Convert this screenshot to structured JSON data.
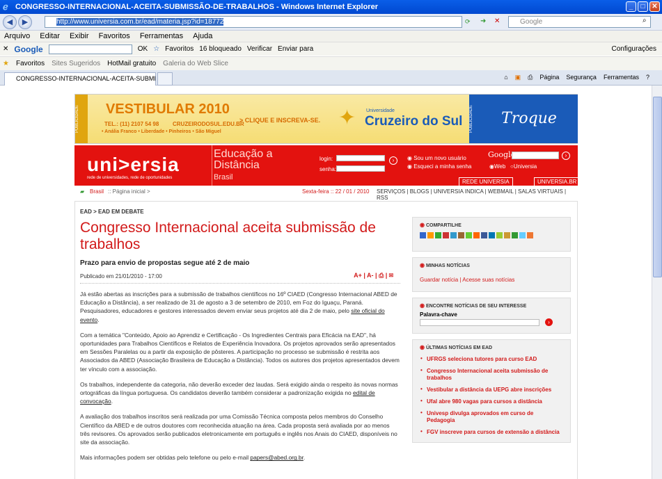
{
  "window": {
    "title": "CONGRESSO-INTERNACIONAL-ACEITA-SUBMISSÃO-DE-TRABALHOS - Windows Internet Explorer"
  },
  "address": {
    "url": "http://www.universia.com.br/ead/materia.jsp?id=18772",
    "search_placeholder": "Google"
  },
  "menu": [
    "Arquivo",
    "Editar",
    "Exibir",
    "Favoritos",
    "Ferramentas",
    "Ajuda"
  ],
  "google_toolbar": {
    "brand": "Google",
    "ok": "OK",
    "favoritos": "Favoritos",
    "bloqueado": "16 bloqueado",
    "verificar": "Verificar",
    "enviar": "Enviar para",
    "config": "Configurações"
  },
  "favbar": {
    "favoritos": "Favoritos",
    "sites": "Sites Sugeridos",
    "hotmail": "HotMail gratuito",
    "galeria": "Galeria do Web Slice"
  },
  "tab": {
    "label": "CONGRESSO-INTERNACIONAL-ACEITA-SUBMISSÃO-..."
  },
  "cmdbar": {
    "pagina": "Página",
    "seguranca": "Segurança",
    "ferramentas": "Ferramentas",
    "help": "?"
  },
  "banner": {
    "publicidade": "PUBLICIDADE",
    "vestibular": "VESTIBULAR 2010",
    "tel": "TEL.: (11) 2107 54 98",
    "site": "CRUZEIRODOSUL.EDU.BR",
    "campi": "• Anália Franco • Liberdade • Pinheiros • São Miguel",
    "cta": "> CLIQUE E INSCREVA-SE.",
    "uni_small": "Universidade",
    "uni": "Cruzeiro do Sul",
    "right": "Troque ideias!"
  },
  "header": {
    "logo": "uni>ersia",
    "tagline": "rede de universidades, rede de oportunidades",
    "section1": "Educação a",
    "section2": "Distância",
    "section3": "Brasil",
    "login": "login:",
    "senha": "senha:",
    "novo": "Sou um novo usuário",
    "esqueci": "Esqueci a minha senha",
    "google": "Google",
    "web": "Web",
    "universia": "Universia",
    "rede": "REDE UNIVERSIA",
    "universia_br": "UNIVERSIA.BR"
  },
  "breadrow": {
    "brasil": "Brasil",
    "home": ":: Página inicial >",
    "date": "Sexta-feira :: 22 / 01 / 2010",
    "links": "SERVIÇOS | BLOGS | UNIVERSIA INDICA | WEBMAIL | SALAS VIRTUAIS | RSS"
  },
  "article": {
    "crumb": "EAD > EAD EM DEBATE",
    "title": "Congresso Internacional aceita submissão de trabalhos",
    "subtitle": "Prazo para envio de propostas segue até 2 de maio",
    "published": "Publicado em 21/01/2010 - 17:00",
    "tools": "A+ | A- | ⎙ | ✉",
    "p1": "Já estão abertas as inscrições para a submissão de trabalhos científicos no 16º CIAED (Congresso Internacional ABED de Educação a Distância), a ser realizado de 31 de agosto a 3 de setembro de 2010, em Foz do Iguaçu, Paraná. Pesquisadores, educadores e gestores interessados devem enviar seus projetos até dia 2 de maio, pelo",
    "p1_link": "site oficial do evento",
    "p2": "Com a temática \"Conteúdo, Apoio ao Aprendiz e Certificação - Os Ingredientes Centrais para Eficácia na EAD\", há oportunidades para Trabalhos Científicos e Relatos de Experiência Inovadora. Os projetos aprovados serão apresentados em Sessões Paralelas ou a partir da exposição de pôsteres. A participação no processo se submissão é restrita aos Associados da ABED (Associação Brasileira de Educação a Distância). Todos os autores dos projetos apresentados devem ter vínculo com a associação.",
    "p3": "Os trabalhos, independente da categoria, não deverão exceder dez laudas. Será exigido ainda o respeito às novas normas ortográficas da língua portuguesa. Os candidatos deverão também considerar a padronização exigida no",
    "p3_link": "edital de convocação",
    "p4": "A avaliação dos trabalhos inscritos será realizada por uma Comissão Técnica composta pelos membros do Conselho Científico da ABED e de outros doutores com reconhecida atuação na área. Cada proposta será avaliada por ao menos três revisores. Os aprovados serão publicados eletronicamente em português e inglês nos Anais do CIAED, disponíveis no site da associação.",
    "p5": "Mais informações podem ser obtidas pelo telefone ou pelo e-mail",
    "p5_link": "papers@abed.org.br"
  },
  "sidebar": {
    "compartilhe": "COMPARTILHE",
    "minhas": "MINHAS NOTÍCIAS",
    "guardar": "Guardar notícia",
    "acesse": "Acesse suas notícias",
    "encontre": "ENCONTRE NOTÍCIAS DE SEU INTERESSE",
    "palavra": "Palavra-chave",
    "ultimas": "ÚLTIMAS NOTÍCIAS EM EAD",
    "news": [
      "UFRGS seleciona tutores para curso EAD",
      "Congresso Internacional aceita submissão de trabalhos",
      "Vestibular a distância da UEPG abre inscrições",
      "Ufal abre 980 vagas para cursos a distância",
      "Univesp divulga aprovados em curso de Pedagogia",
      "FGV inscreve para cursos de extensão a distância"
    ]
  },
  "colors": {
    "brand_red": "#e3120f",
    "headline_red": "#d21a1a",
    "ie_blue": "#0a5ee8"
  }
}
